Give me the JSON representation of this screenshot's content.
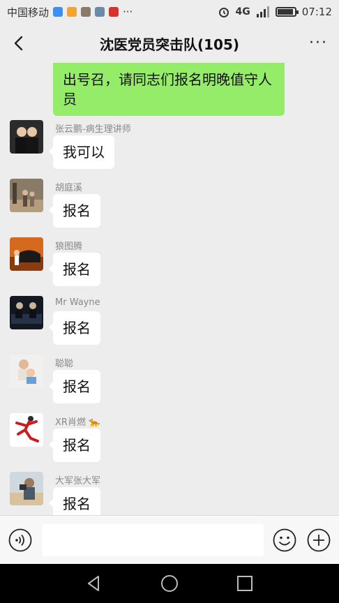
{
  "status_bar": {
    "carrier": "中国移动",
    "more": "···",
    "network": "4G",
    "network2": "4G",
    "time": "07:12",
    "battery_level": 0.85
  },
  "header": {
    "title": "沈医党员突击队(105)"
  },
  "sent_message": {
    "text": "出号召，请同志们报名明晚值守人员"
  },
  "messages": [
    {
      "sender": "张云鹏-病生理讲师",
      "text": "我可以"
    },
    {
      "sender": "胡庭溪",
      "text": "报名"
    },
    {
      "sender": "狼图腾",
      "text": "报名"
    },
    {
      "sender": "Mr Wayne",
      "text": "报名"
    },
    {
      "sender": "聪聪",
      "text": "报名"
    },
    {
      "sender": "XR肖燃 🐆",
      "text": "报名"
    },
    {
      "sender": "大军张大军",
      "text": "报名"
    }
  ],
  "input": {
    "placeholder": ""
  }
}
